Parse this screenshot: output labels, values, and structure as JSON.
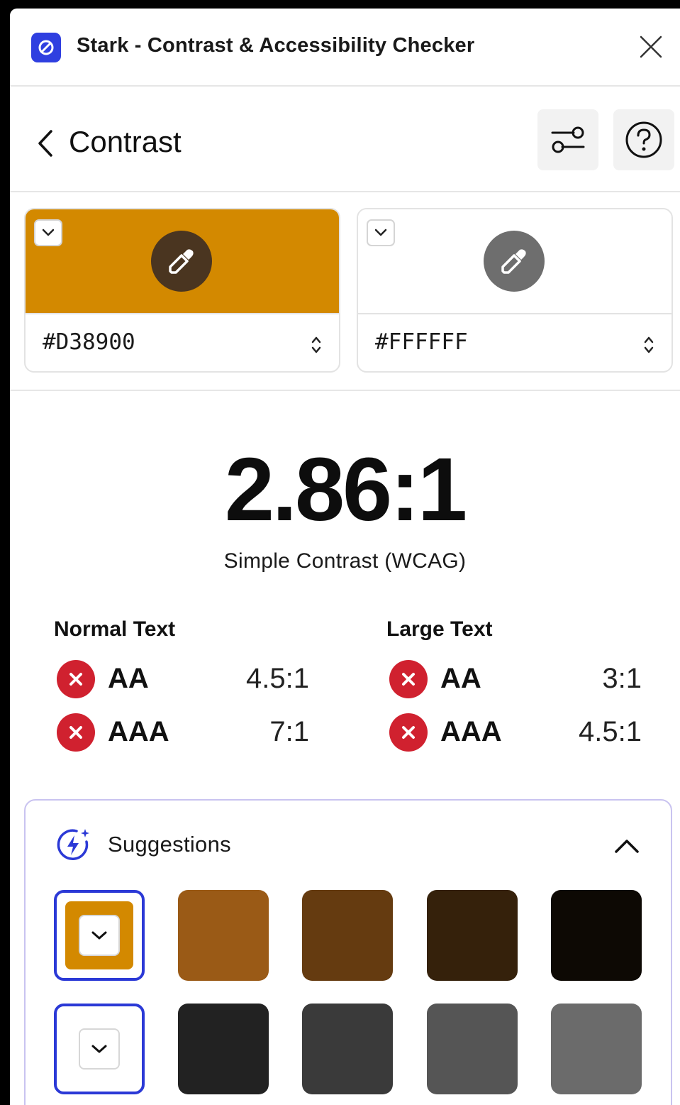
{
  "window": {
    "title": "Stark - Contrast & Accessibility Checker"
  },
  "header": {
    "title": "Contrast"
  },
  "colors": {
    "foreground": {
      "hex": "#D38900",
      "swatch_color": "#D38900",
      "eyedropper_bg": "#4a3520"
    },
    "background": {
      "hex": "#FFFFFF",
      "swatch_color": "#FFFFFF",
      "eyedropper_bg": "#6e6e6e"
    }
  },
  "result": {
    "ratio": "2.86:1",
    "method": "Simple Contrast (WCAG)"
  },
  "normal_text": {
    "title": "Normal Text",
    "rows": [
      {
        "level": "AA",
        "required": "4.5:1",
        "status": "fail"
      },
      {
        "level": "AAA",
        "required": "7:1",
        "status": "fail"
      }
    ]
  },
  "large_text": {
    "title": "Large Text",
    "rows": [
      {
        "level": "AA",
        "required": "3:1",
        "status": "fail"
      },
      {
        "level": "AAA",
        "required": "4.5:1",
        "status": "fail"
      }
    ]
  },
  "suggestions": {
    "title": "Suggestions",
    "row1": [
      "#D38900",
      "#9A5A16",
      "#653B10",
      "#35210B",
      "#0D0904"
    ],
    "row2": [
      "#FFFFFF",
      "#222222",
      "#3A3A3A",
      "#555555",
      "#6B6B6B"
    ]
  },
  "accent": "#2B39D6",
  "fail_color": "#D0212F"
}
